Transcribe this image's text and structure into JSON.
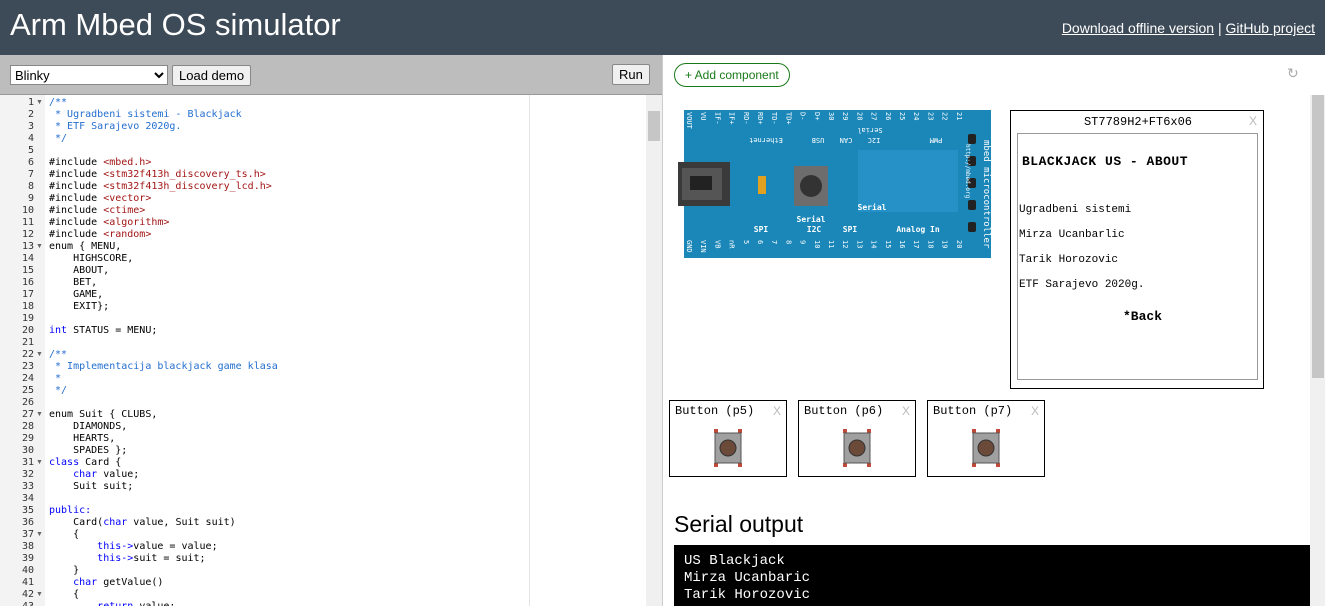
{
  "header": {
    "title": "Arm Mbed OS simulator",
    "link_download": "Download offline version",
    "separator": "|",
    "link_github": "GitHub project"
  },
  "toolbar": {
    "demo_selected": "Blinky",
    "load_label": "Load demo",
    "run_label": "Run"
  },
  "editor": {
    "lines": [
      {
        "n": "1",
        "fold": true,
        "text": "/**",
        "cls": "c"
      },
      {
        "n": "2",
        "text": " * Ugradbeni sistemi - Blackjack",
        "cls": "c"
      },
      {
        "n": "3",
        "text": " * ETF Sarajevo 2020g.",
        "cls": "c"
      },
      {
        "n": "4",
        "text": " */",
        "cls": "c"
      },
      {
        "n": "5",
        "text": ""
      },
      {
        "n": "6",
        "text": "#include <mbed.h>",
        "cls": "inc"
      },
      {
        "n": "7",
        "text": "#include <stm32f413h_discovery_ts.h>",
        "cls": "inc"
      },
      {
        "n": "8",
        "text": "#include <stm32f413h_discovery_lcd.h>",
        "cls": "inc"
      },
      {
        "n": "9",
        "text": "#include <vector>",
        "cls": "inc"
      },
      {
        "n": "10",
        "text": "#include <ctime>",
        "cls": "inc"
      },
      {
        "n": "11",
        "text": "#include <algorithm>",
        "cls": "inc"
      },
      {
        "n": "12",
        "text": "#include <random>",
        "cls": "inc"
      },
      {
        "n": "13",
        "fold": true,
        "text": "enum { MENU,"
      },
      {
        "n": "14",
        "text": "    HIGHSCORE,"
      },
      {
        "n": "15",
        "text": "    ABOUT,"
      },
      {
        "n": "16",
        "text": "    BET,"
      },
      {
        "n": "17",
        "text": "    GAME,"
      },
      {
        "n": "18",
        "text": "    EXIT};"
      },
      {
        "n": "19",
        "text": ""
      },
      {
        "n": "20",
        "text": "int STATUS = MENU;",
        "cls": "kw1"
      },
      {
        "n": "21",
        "text": ""
      },
      {
        "n": "22",
        "fold": true,
        "text": "/**",
        "cls": "c"
      },
      {
        "n": "23",
        "text": " * Implementacija blackjack game klasa",
        "cls": "c"
      },
      {
        "n": "24",
        "text": " *",
        "cls": "c"
      },
      {
        "n": "25",
        "text": " */",
        "cls": "c"
      },
      {
        "n": "26",
        "text": ""
      },
      {
        "n": "27",
        "fold": true,
        "text": "enum Suit { CLUBS,"
      },
      {
        "n": "28",
        "text": "    DIAMONDS,"
      },
      {
        "n": "29",
        "text": "    HEARTS,"
      },
      {
        "n": "30",
        "text": "    SPADES };"
      },
      {
        "n": "31",
        "fold": true,
        "text": "class Card {",
        "cls": "kw1"
      },
      {
        "n": "32",
        "text": "    char value;",
        "cls": "kw2"
      },
      {
        "n": "33",
        "text": "    Suit suit;"
      },
      {
        "n": "34",
        "text": ""
      },
      {
        "n": "35",
        "text": "public:",
        "cls": "kwall"
      },
      {
        "n": "36",
        "text": "    Card(char value, Suit suit)",
        "cls": "card"
      },
      {
        "n": "37",
        "fold": true,
        "text": "    {"
      },
      {
        "n": "38",
        "text": "        this->value = value;",
        "cls": "this"
      },
      {
        "n": "39",
        "text": "        this->suit = suit;",
        "cls": "this"
      },
      {
        "n": "40",
        "text": "    }"
      },
      {
        "n": "41",
        "text": "    char getValue()",
        "cls": "kw2"
      },
      {
        "n": "42",
        "fold": true,
        "text": "    {"
      },
      {
        "n": "43",
        "text": "        return value;",
        "cls": "ret"
      }
    ]
  },
  "components": {
    "add_label": "+ Add component",
    "refresh_icon": "refresh-icon",
    "lcd": {
      "title": "ST7789H2+FT6x06",
      "close": "X",
      "screen": {
        "heading": "BLACKJACK US - ABOUT",
        "line1": "Ugradbeni sistemi",
        "line2": "Mirza Ucanbarlic",
        "line3": "Tarik Horozovic",
        "line4": "ETF Sarajevo 2020g.",
        "back": "*Back"
      }
    },
    "buttons": [
      {
        "label": "Button (p5)",
        "close": "X"
      },
      {
        "label": "Button (p6)",
        "close": "X"
      },
      {
        "label": "Button (p7)",
        "close": "X"
      }
    ],
    "board": {
      "top_pins": [
        "VOUT",
        "VU",
        "IF-",
        "IF+",
        "RD-",
        "RD+",
        "TD-",
        "TD+",
        "D-",
        "D+",
        "30",
        "29",
        "28",
        "27",
        "26",
        "25",
        "24",
        "23",
        "22",
        "21"
      ],
      "bottom_pins": [
        "GND",
        "VIN",
        "VB",
        "nR",
        "5",
        "6",
        "7",
        "8",
        "9",
        "10",
        "11",
        "12",
        "13",
        "14",
        "15",
        "16",
        "17",
        "18",
        "19",
        "20"
      ],
      "labels_top": [
        "Ethernet",
        "USB",
        "CAN",
        "I2C",
        "Serial",
        "PWM"
      ],
      "labels_bottom": [
        "SPI",
        "I2C",
        "SPI",
        "Analog In"
      ],
      "labels_mid": [
        "Serial",
        "Serial"
      ],
      "side_text": "mbed microcontroller",
      "side_url": "http://mbed.org",
      "colors": {
        "board": "#1b87b8",
        "accent": "#ffffff"
      }
    }
  },
  "serial": {
    "title": "Serial output",
    "lines": [
      "US Blackjack",
      "Mirza Ucanbaric",
      "Tarik Horozovic"
    ]
  },
  "colors": {
    "topbar": "#3d4a57",
    "comment": "#236e24",
    "include_path": "#a31515",
    "keyword": "#0000ff",
    "add_button": "#1a7a1a"
  }
}
